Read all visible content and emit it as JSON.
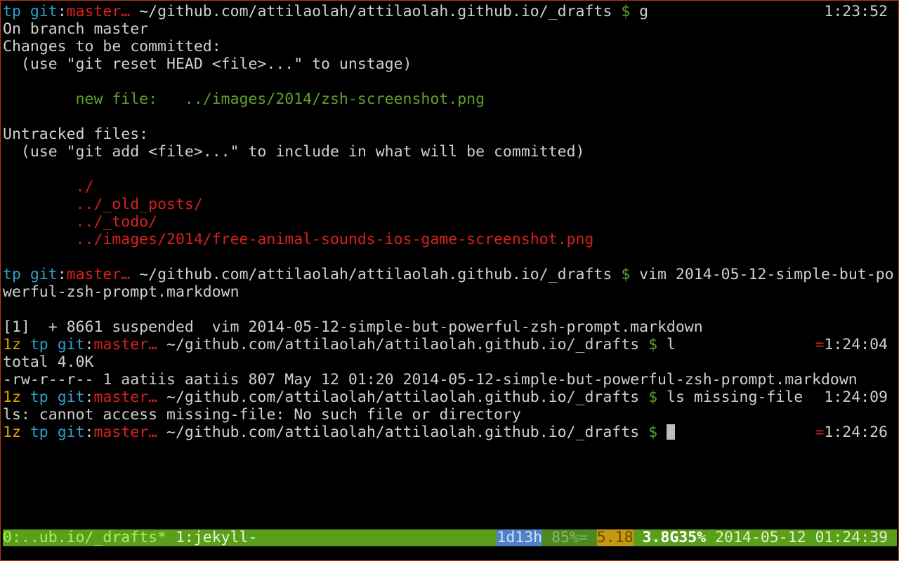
{
  "prompt": {
    "jobs": "1z",
    "host": "tp",
    "git_label": "git",
    "branch": "master…",
    "cwd": "~/github.com/attilaolah/attilaolah.github.io/_drafts",
    "symbol": "$"
  },
  "session": [
    {
      "kind": "prompt",
      "jobs": "",
      "command": "g",
      "right": "1:23:52",
      "right_mark": ""
    },
    {
      "kind": "text",
      "text": "On branch master"
    },
    {
      "kind": "text",
      "text": "Changes to be committed:"
    },
    {
      "kind": "text",
      "text": "  (use \"git reset HEAD <file>...\" to unstage)"
    },
    {
      "kind": "blank"
    },
    {
      "kind": "text",
      "color": "green",
      "text": "        new file:   ../images/2014/zsh-screenshot.png"
    },
    {
      "kind": "blank"
    },
    {
      "kind": "text",
      "text": "Untracked files:"
    },
    {
      "kind": "text",
      "text": "  (use \"git add <file>...\" to include in what will be committed)"
    },
    {
      "kind": "blank"
    },
    {
      "kind": "text",
      "color": "red",
      "text": "        ./"
    },
    {
      "kind": "text",
      "color": "red",
      "text": "        ../_old_posts/"
    },
    {
      "kind": "text",
      "color": "red",
      "text": "        ../_todo/"
    },
    {
      "kind": "text",
      "color": "red",
      "text": "        ../images/2014/free-animal-sounds-ios-game-screenshot.png"
    },
    {
      "kind": "blank"
    },
    {
      "kind": "prompt",
      "jobs": "",
      "command": "vim 2014-05-12-simple-but-po",
      "right": "",
      "right_mark": ""
    },
    {
      "kind": "text",
      "text": "werful-zsh-prompt.markdown"
    },
    {
      "kind": "blank"
    },
    {
      "kind": "text",
      "text": "[1]  + 8661 suspended  vim 2014-05-12-simple-but-powerful-zsh-prompt.markdown"
    },
    {
      "kind": "prompt",
      "jobs": "1z",
      "command": "l",
      "right": "1:24:04",
      "right_mark": "="
    },
    {
      "kind": "text",
      "text": "total 4.0K"
    },
    {
      "kind": "text",
      "text": "-rw-r--r-- 1 aatiis aatiis 807 May 12 01:20 2014-05-12-simple-but-powerful-zsh-prompt.markdown"
    },
    {
      "kind": "prompt",
      "jobs": "1z",
      "command": "ls missing-file",
      "right": "1:24:09",
      "right_mark": ""
    },
    {
      "kind": "text",
      "text": "ls: cannot access missing-file: No such file or directory"
    },
    {
      "kind": "prompt",
      "jobs": "1z",
      "command": "",
      "cursor": true,
      "right": "1:24:26",
      "right_mark": "="
    }
  ],
  "statusbar": {
    "window_active": "0:..ub.io/_drafts*",
    "window_other": "1:jekyll-",
    "uptime": "1d13h",
    "battery": "85%=",
    "load": "5.18",
    "memory": "3.8G35%",
    "datetime": "2014-05-12 01:24:39"
  },
  "colors": {
    "background": "#000000",
    "border": "#b8351b",
    "text": "#d0d0d0",
    "host": "#2aa3c9",
    "branch": "#d9201c",
    "dollar": "#5fa22a",
    "staged": "#5fa22a",
    "untracked": "#d9201c",
    "jobs": "#e6a000",
    "statusbar": "#5a9f1a"
  }
}
